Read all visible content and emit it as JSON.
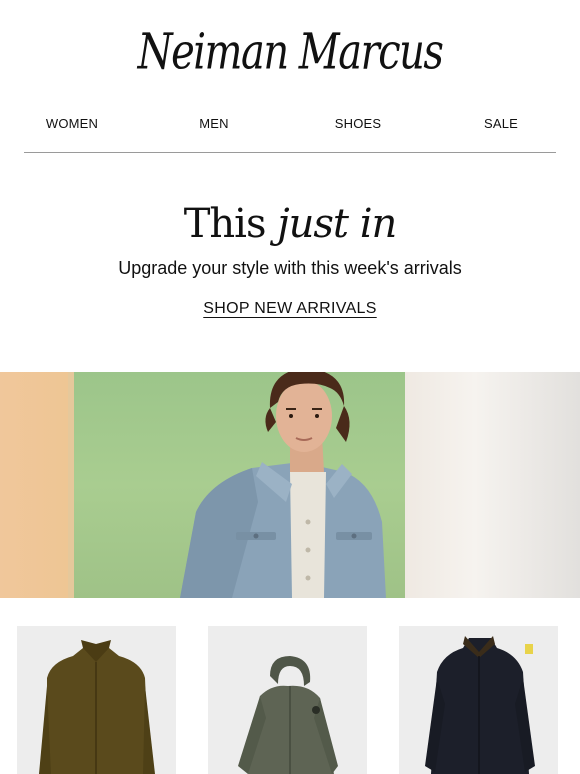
{
  "brand": {
    "logo_text": "Neiman Marcus"
  },
  "nav": {
    "items": [
      "WOMEN",
      "MEN",
      "SHOES",
      "SALE"
    ]
  },
  "promo": {
    "headline_regular": "This",
    "headline_italic": "just in",
    "subhead": "Upgrade your style with this week's arrivals",
    "cta_label": "SHOP NEW ARRIVALS"
  },
  "hero": {
    "image_subject": "man-in-suede-jacket"
  },
  "products": [
    {
      "image_subject": "olive-shirt-jacket",
      "color": "#5a4a1c"
    },
    {
      "image_subject": "green-hooded-parka",
      "color": "#5e6454"
    },
    {
      "image_subject": "navy-car-coat",
      "color": "#1c1f2a"
    }
  ]
}
